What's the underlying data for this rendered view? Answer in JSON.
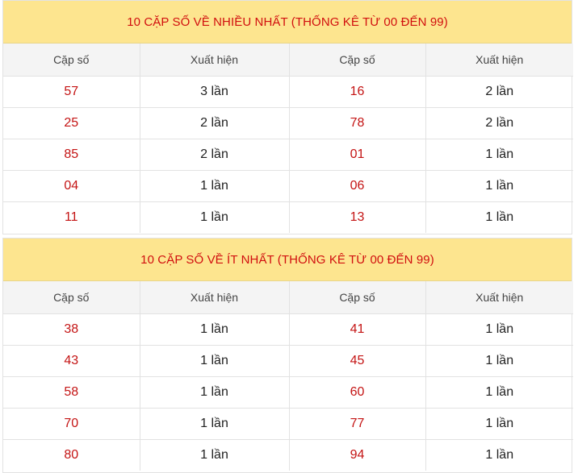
{
  "headers": {
    "pair": "Cặp số",
    "appear": "Xuất hiện"
  },
  "most": {
    "title": "10 CẶP SỐ VỀ NHIỀU NHẤT (THỐNG KÊ TỪ 00 ĐẾN 99)",
    "rows": [
      {
        "a": "57",
        "a_count": "3 lần",
        "b": "16",
        "b_count": "2 lần"
      },
      {
        "a": "25",
        "a_count": "2 lần",
        "b": "78",
        "b_count": "2 lần"
      },
      {
        "a": "85",
        "a_count": "2 lần",
        "b": "01",
        "b_count": "1 lần"
      },
      {
        "a": "04",
        "a_count": "1 lần",
        "b": "06",
        "b_count": "1 lần"
      },
      {
        "a": "11",
        "a_count": "1 lần",
        "b": "13",
        "b_count": "1 lần"
      }
    ]
  },
  "least": {
    "title": "10 CẶP SỐ VỀ ÍT NHẤT (THỐNG KÊ TỪ 00 ĐẾN 99)",
    "rows": [
      {
        "a": "38",
        "a_count": "1 lần",
        "b": "41",
        "b_count": "1 lần"
      },
      {
        "a": "43",
        "a_count": "1 lần",
        "b": "45",
        "b_count": "1 lần"
      },
      {
        "a": "58",
        "a_count": "1 lần",
        "b": "60",
        "b_count": "1 lần"
      },
      {
        "a": "70",
        "a_count": "1 lần",
        "b": "77",
        "b_count": "1 lần"
      },
      {
        "a": "80",
        "a_count": "1 lần",
        "b": "94",
        "b_count": "1 lần"
      }
    ]
  },
  "colors": {
    "title_bg": "#fde58f",
    "title_text": "#d10f0f",
    "number_text": "#c41414",
    "header_bg": "#f4f4f4"
  }
}
